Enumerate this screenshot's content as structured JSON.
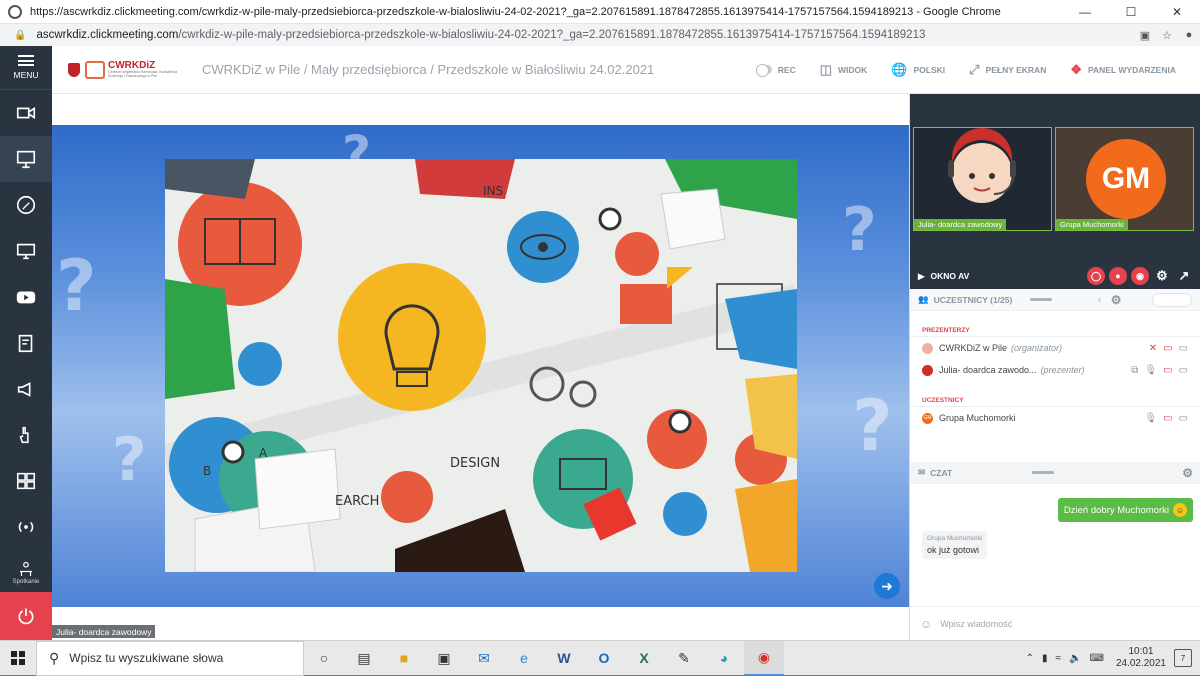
{
  "browser": {
    "title": "https://ascwrkdiz.clickmeeting.com/cwrkdiz-w-pile-maly-przedsiebiorca-przedszkole-w-bialosliwiu-24-02-2021?_ga=2.207615891.1878472855.1613975414-1757157564.1594189213 - Google Chrome",
    "host": "ascwrkdiz.clickmeeting.com",
    "path": "/cwrkdiz-w-pile-maly-przedsiebiorca-przedszkole-w-bialosliwiu-24-02-2021?_ga=2.207615891.1878472855.1613975414-1757157564.1594189213"
  },
  "sidebar": {
    "menu_label": "MENU",
    "meeting_label": "Spotkanie"
  },
  "header": {
    "logo_text": "CWRKDiZ",
    "logo_sub": "Centrum Wspierania Rzemiosła, Kształcenia Dualnego i Zawodowego w Pile",
    "event_title": "CWRKDiZ w Pile / Mały przedsiębiorca / Przedszkole w Białośliwiu 24.02.2021",
    "rec": "REC",
    "view": "WIDOK",
    "language": "POLSKI",
    "fullscreen": "PEŁNY EKRAN",
    "panel": "PANEL WYDARZENIA"
  },
  "stage": {
    "presenter_tag": "Julia- doardca zawodowy",
    "slide_words": {
      "design": "DESIGN",
      "search": "EARCH",
      "ins": "INS",
      "a": "A",
      "b": "B"
    }
  },
  "av": {
    "tile1_label": "Julia- doardca zawodowy",
    "tile2_label": "Grupa Muchomorki",
    "tile2_initials": "GM",
    "window_label": "OKNO AV"
  },
  "participants": {
    "header": "UCZESTNICY (1/25)",
    "presenters_group": "PREZENTERZY",
    "attendees_group": "UCZESTNICY",
    "rows": [
      {
        "name": "CWRKDiZ w Pile",
        "role": "(organizator)"
      },
      {
        "name": "Julia- doardca zawodo...",
        "role": "(prezenter)"
      },
      {
        "name": "Grupa Muchomorki",
        "role": ""
      }
    ],
    "gm_avatar": "GM"
  },
  "chat": {
    "header": "CZAT",
    "out_msg": "Dzień dobry Muchomorki",
    "in_author": "Grupa Muchomorki",
    "in_msg": "ok już gotowi",
    "placeholder": "Wpisz wiadomość"
  },
  "taskbar": {
    "search_placeholder": "Wpisz tu wyszukiwane słowa",
    "time": "10:01",
    "date": "24.02.2021",
    "notif_count": "7"
  }
}
